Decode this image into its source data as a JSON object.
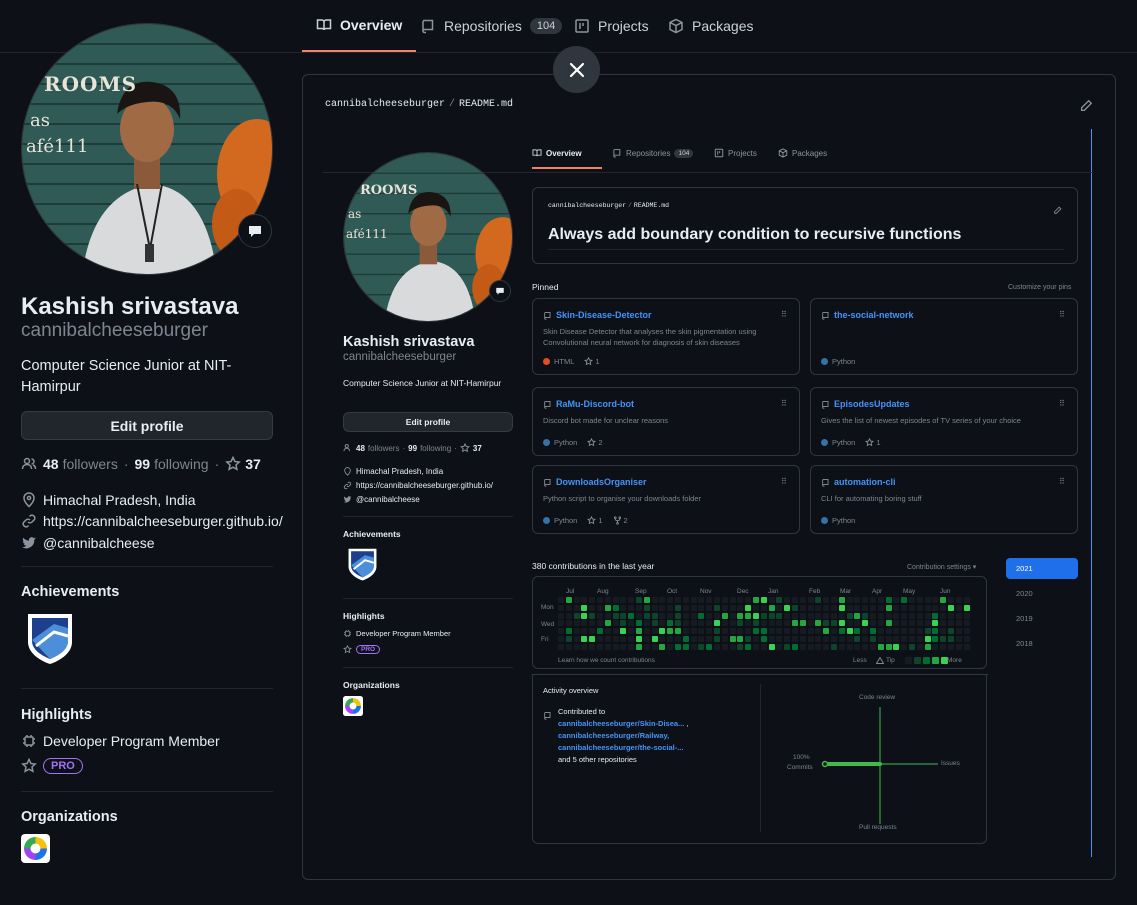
{
  "nav": {
    "tabs": [
      {
        "label": "Overview"
      },
      {
        "label": "Repositories",
        "count": "104"
      },
      {
        "label": "Projects"
      },
      {
        "label": "Packages"
      }
    ]
  },
  "profile": {
    "name": "Kashish srivastava",
    "login": "cannibalcheeseburger",
    "bio": "Computer Science Junior at NIT-Hamirpur",
    "edit_button": "Edit profile",
    "followers_count": "48",
    "followers_label": "followers",
    "separator": "·",
    "following_count": "99",
    "following_label": "following",
    "stars_count": "37",
    "location": "Himachal Pradesh, India",
    "website": "https://cannibalcheeseburger.github.io/",
    "twitter": "@cannibalcheese",
    "achievements_title": "Achievements",
    "highlights_title": "Highlights",
    "highlight_item": "Developer Program Member",
    "pro_badge": "PRO",
    "organizations_title": "Organizations",
    "avatar_wall_text": "ROOMS",
    "avatar_wall_text2": "as",
    "avatar_wall_text3": "afé111"
  },
  "readme": {
    "user": "cannibalcheeseburger",
    "slash": "/",
    "file": "README.md",
    "heading": "Always add boundary condition to recursive functions"
  },
  "pinned": {
    "title": "Pinned",
    "customize": "Customize your pins",
    "repos": [
      {
        "name": "Skin-Disease-Detector",
        "desc": "Skin Disease Detector that analyses the skin pigmentation using Convolutional neural network for diagnosis of skin diseases",
        "lang": "HTML",
        "lang_color": "#e34c26",
        "stars": "1",
        "forks": ""
      },
      {
        "name": "the-social-network",
        "desc": "",
        "lang": "Python",
        "lang_color": "#3572A5",
        "stars": "",
        "forks": ""
      },
      {
        "name": "RaMu-Discord-bot",
        "desc": "Discord bot made for unclear reasons",
        "lang": "Python",
        "lang_color": "#3572A5",
        "stars": "2",
        "forks": ""
      },
      {
        "name": "EpisodesUpdates",
        "desc": "Gives the list of newest episodes of TV series of your choice",
        "lang": "Python",
        "lang_color": "#3572A5",
        "stars": "1",
        "forks": ""
      },
      {
        "name": "DownloadsOrganiser",
        "desc": "Python script to organise your downloads folder",
        "lang": "Python",
        "lang_color": "#3572A5",
        "stars": "1",
        "forks": "2"
      },
      {
        "name": "automation-cli",
        "desc": "CLI for automating boring stuff",
        "lang": "Python",
        "lang_color": "#3572A5",
        "stars": "",
        "forks": ""
      }
    ]
  },
  "contributions": {
    "title": "380 contributions in the last year",
    "settings": "Contribution settings ▾",
    "months": [
      "Jul",
      "Aug",
      "Sep",
      "Oct",
      "Nov",
      "Dec",
      "Jan",
      "Feb",
      "Mar",
      "Apr",
      "May",
      "Jun"
    ],
    "days": [
      "Mon",
      "Wed",
      "Fri"
    ],
    "learn": "Learn how we count contributions",
    "less": "Less",
    "tip": "Tip",
    "more": "More",
    "years": [
      "2021",
      "2020",
      "2019",
      "2018"
    ],
    "colors": [
      "#161b22",
      "#0e4429",
      "#006d32",
      "#26a641",
      "#39d353"
    ]
  },
  "activity": {
    "title": "Activity overview",
    "contributed_to": "Contributed to",
    "repo1": "cannibalcheeseburger/Skin-Disea...",
    "repo1_suffix": ",",
    "repo2": "cannibalcheeseburger/Railway,",
    "repo3": "cannibalcheeseburger/the-social-...",
    "others": "and 5 other repositories",
    "axis": {
      "code_review": "Code review",
      "issues": "Issues",
      "pull_requests": "Pull requests",
      "commits_pct": "100%",
      "commits": "Commits"
    }
  },
  "colors": {
    "accent": "#f78166",
    "link": "#4493f8",
    "pro": "#a371f7",
    "graph_green": "#3fb950"
  }
}
